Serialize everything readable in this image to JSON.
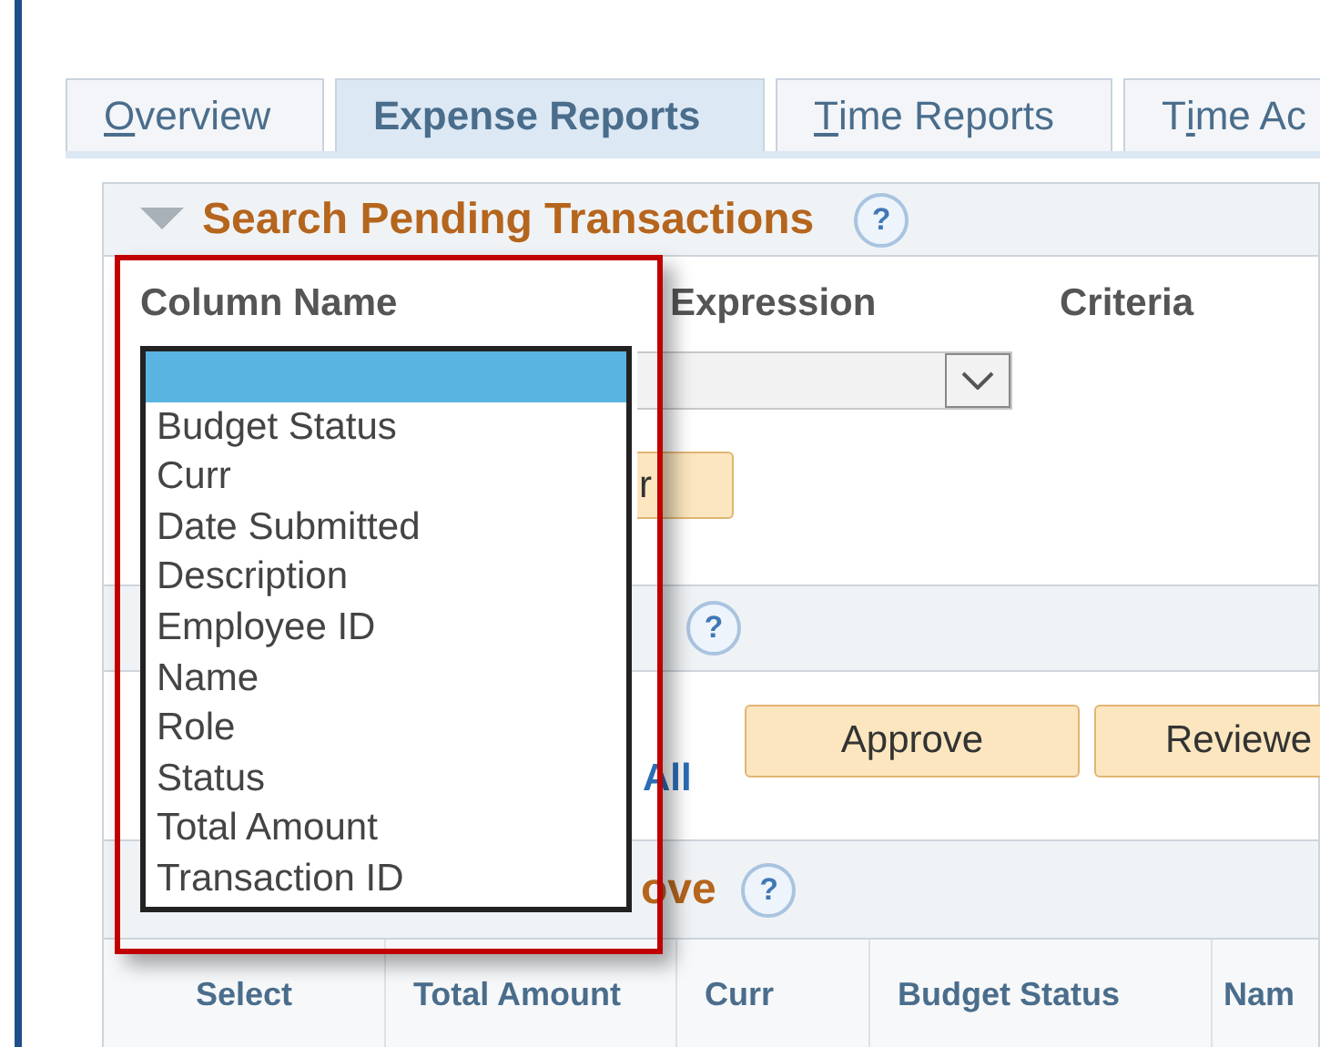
{
  "tabs": [
    {
      "parts": [
        {
          "text": "O",
          "underlined": true
        },
        {
          "text": "verview",
          "underlined": false
        }
      ],
      "selected": false
    },
    {
      "parts": [
        {
          "text": "Expense Reports",
          "underlined": false
        }
      ],
      "selected": true
    },
    {
      "parts": [
        {
          "text": "T",
          "underlined": true
        },
        {
          "text": "ime Reports",
          "underlined": false
        }
      ],
      "selected": false
    },
    {
      "parts": [
        {
          "text": "T",
          "underlined": false
        },
        {
          "text": "i",
          "underlined": true
        },
        {
          "text": "me Ac",
          "underlined": false
        }
      ],
      "selected": false
    }
  ],
  "search_section": {
    "title": "Search Pending Transactions",
    "help": "?",
    "expanded": true,
    "columns": [
      "Column Name",
      "Expression",
      "Criteria"
    ],
    "button": "r"
  },
  "actions_section": {
    "help": "?",
    "link": "All",
    "buttons": [
      "Approve",
      "Reviewe"
    ]
  },
  "results_section": {
    "title": "ove",
    "help": "?",
    "columns": [
      "Select",
      "Total Amount",
      "Curr",
      "Budget Status",
      "Nam"
    ]
  },
  "column_list": {
    "items": [
      {
        "selected": true
      },
      {
        "label": "Budget Status",
        "selected": false
      },
      {
        "label": "Curr",
        "selected": false
      },
      {
        "label": "Date Submitted",
        "selected": false
      },
      {
        "label": "Description",
        "selected": false
      },
      {
        "label": "Employee ID",
        "selected": false
      },
      {
        "label": "Name",
        "selected": false
      },
      {
        "label": "Role",
        "selected": false
      },
      {
        "label": "Status",
        "selected": false
      },
      {
        "label": "Total Amount",
        "selected": false
      },
      {
        "label": "Transaction ID",
        "selected": false
      }
    ]
  }
}
